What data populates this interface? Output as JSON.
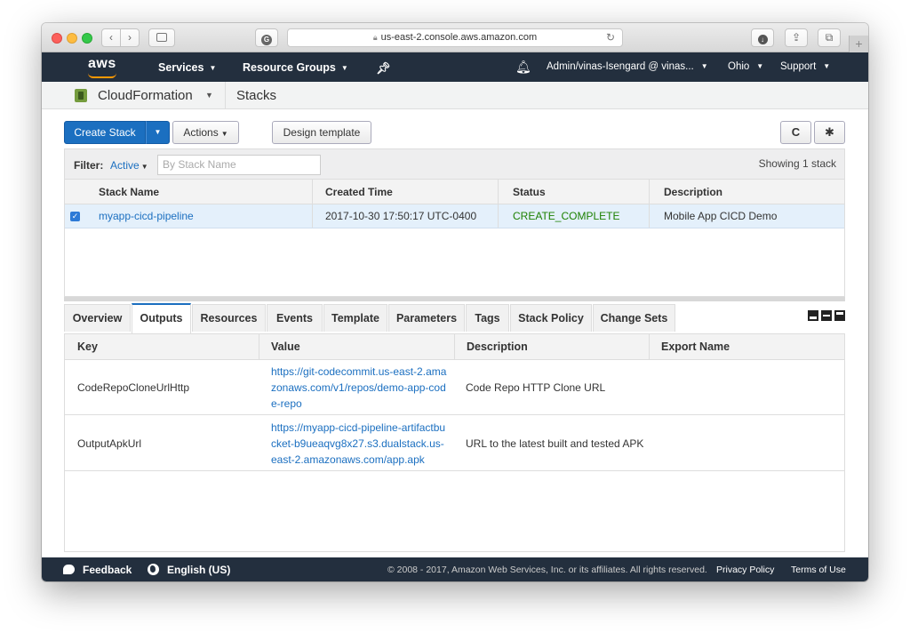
{
  "browser": {
    "url": "us-east-2.console.aws.amazon.com"
  },
  "aws_nav": {
    "logo": "aws",
    "services": "Services",
    "resource_groups": "Resource Groups",
    "account": "Admin/vinas-Isengard @ vinas...",
    "region": "Ohio",
    "support": "Support"
  },
  "service_bar": {
    "service": "CloudFormation",
    "page": "Stacks"
  },
  "toolbar": {
    "create_stack": "Create Stack",
    "actions": "Actions",
    "design_template": "Design template",
    "refresh_glyph": "C",
    "gear_glyph": "✱"
  },
  "filter": {
    "label": "Filter:",
    "status": "Active",
    "placeholder": "By Stack Name",
    "count": "Showing 1 stack"
  },
  "stacks_table": {
    "headers": [
      "Stack Name",
      "Created Time",
      "Status",
      "Description"
    ],
    "rows": [
      {
        "name": "myapp-cicd-pipeline",
        "created": "2017-10-30 17:50:17 UTC-0400",
        "status": "CREATE_COMPLETE",
        "description": "Mobile App CICD Demo"
      }
    ]
  },
  "detail_tabs": [
    "Overview",
    "Outputs",
    "Resources",
    "Events",
    "Template",
    "Parameters",
    "Tags",
    "Stack Policy",
    "Change Sets"
  ],
  "outputs_table": {
    "headers": [
      "Key",
      "Value",
      "Description",
      "Export Name"
    ],
    "rows": [
      {
        "key": "CodeRepoCloneUrlHttp",
        "value": "https://git-codecommit.us-east-2.amazonaws.com/v1/repos/demo-app-code-repo",
        "description": "Code Repo HTTP Clone URL",
        "export": ""
      },
      {
        "key": "OutputApkUrl",
        "value": "https://myapp-cicd-pipeline-artifactbucket-b9ueaqvg8x27.s3.dualstack.us-east-2.amazonaws.com/app.apk",
        "description": "URL to the latest built and tested APK",
        "export": ""
      }
    ]
  },
  "footer": {
    "feedback": "Feedback",
    "language": "English (US)",
    "copyright": "© 2008 - 2017, Amazon Web Services, Inc. or its affiliates. All rights reserved.",
    "privacy": "Privacy Policy",
    "terms": "Terms of Use"
  },
  "colors": {
    "aws_nav": "#232f3e",
    "primary_button": "#1b6fc0",
    "status_complete": "#1d8102",
    "selected_row": "#e4f0fb"
  }
}
